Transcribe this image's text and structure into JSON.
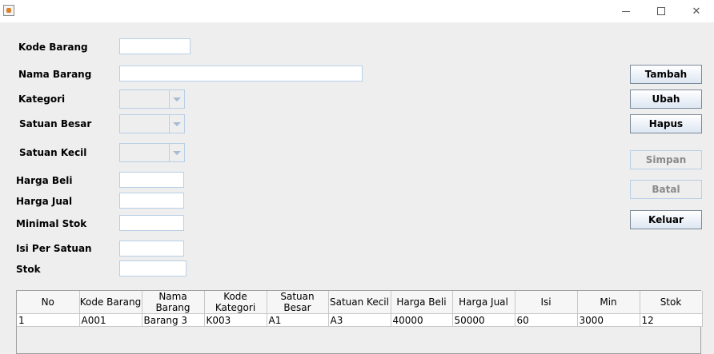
{
  "window": {
    "icons": {
      "app": "java-cup-icon",
      "minimize": "minimize-icon",
      "maximize": "maximize-icon",
      "close": "close-icon"
    },
    "close_glyph": "✕"
  },
  "form": {
    "kode_barang": {
      "label": "Kode Barang",
      "value": ""
    },
    "nama_barang": {
      "label": "Nama Barang",
      "value": ""
    },
    "kategori": {
      "label": "Kategori",
      "value": ""
    },
    "satuan_besar": {
      "label": "Satuan Besar",
      "value": ""
    },
    "satuan_kecil": {
      "label": "Satuan Kecil",
      "value": ""
    },
    "harga_beli": {
      "label": "Harga Beli",
      "value": ""
    },
    "harga_jual": {
      "label": "Harga Jual",
      "value": ""
    },
    "minimal_stok": {
      "label": "Minimal Stok",
      "value": ""
    },
    "isi_per_satuan": {
      "label": "Isi Per Satuan",
      "value": ""
    },
    "stok": {
      "label": "Stok",
      "value": ""
    }
  },
  "buttons": {
    "tambah": "Tambah",
    "ubah": "Ubah",
    "hapus": "Hapus",
    "simpan": "Simpan",
    "batal": "Batal",
    "keluar": "Keluar"
  },
  "table": {
    "columns": [
      "No",
      "Kode Barang",
      "Nama Barang",
      "Kode Kategori",
      "Satuan Besar",
      "Satuan Kecil",
      "Harga Beli",
      "Harga Jual",
      "Isi",
      "Min",
      "Stok"
    ],
    "rows": [
      [
        "1",
        "A001",
        "Barang 3",
        "K003",
        "A1",
        "A3",
        "40000",
        "50000",
        "60",
        "3000",
        "12"
      ]
    ]
  },
  "colors": {
    "border": "#b8cfe5",
    "background": "#eeeeee",
    "disabled_text": "#8a8a8a"
  }
}
